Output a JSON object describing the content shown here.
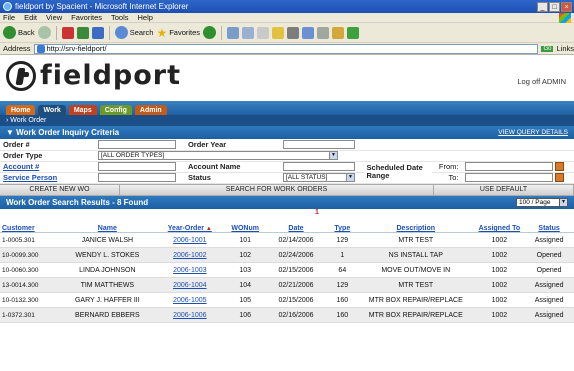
{
  "window": {
    "title": "fieldport by Spacient - Microsoft Internet Explorer"
  },
  "menu": [
    "File",
    "Edit",
    "View",
    "Favorites",
    "Tools",
    "Help"
  ],
  "toolbar": {
    "back": "Back",
    "search": "Search",
    "favorites": "Favorites"
  },
  "address": {
    "label": "Address",
    "url": "http://srv-fieldport/",
    "go": "Go",
    "links": "Links"
  },
  "brand": {
    "name": "fieldport",
    "logoff": "Log off ADMIN"
  },
  "tabs": [
    "Home",
    "Work",
    "Maps",
    "Config",
    "Admin"
  ],
  "subnav": "› Work Order",
  "inquiry": {
    "title": "Work Order Inquiry Criteria",
    "view_query": "VIEW QUERY DETAILS",
    "order_num": "Order #",
    "order_year": "Order Year",
    "order_type": "Order Type",
    "order_type_value": "[ALL ORDER TYPES]",
    "account_num": "Account #",
    "account_name": "Account Name",
    "scheduled_range": "Scheduled Date Range",
    "from": "From:",
    "to": "To:",
    "service_person": "Service Person",
    "status": "Status",
    "status_value": "[ALL STATUS]"
  },
  "buttons": {
    "create": "CREATE NEW WO",
    "search": "SEARCH FOR WORK ORDERS",
    "default": "USE DEFAULT"
  },
  "results": {
    "title": "Work Order Search Results - 8 Found",
    "per_page": "100 / Page",
    "page_indicator": "1",
    "headers": [
      "Customer",
      "Name",
      "Year-Order",
      "WONum",
      "Date",
      "Type",
      "Description",
      "Assigned To",
      "Status"
    ],
    "rows": [
      [
        "1-0005.301",
        "JANICE WALSH",
        "2006-1001",
        "101",
        "02/14/2006",
        "129",
        "MTR TEST",
        "1002",
        "Assigned"
      ],
      [
        "10-0099.300",
        "WENDY L. STOKES",
        "2006-1002",
        "102",
        "02/24/2006",
        "1",
        "NS INSTALL TAP",
        "1002",
        "Opened"
      ],
      [
        "10-0060.300",
        "LINDA JOHNSON",
        "2006-1003",
        "103",
        "02/15/2006",
        "64",
        "MOVE OUT/MOVE IN",
        "1002",
        "Opened"
      ],
      [
        "13-0014.300",
        "TIM MATTHEWS",
        "2006-1004",
        "104",
        "02/21/2006",
        "129",
        "MTR TEST",
        "1002",
        "Assigned"
      ],
      [
        "10-0132.300",
        "GARY J. HAFFER III",
        "2006-1005",
        "105",
        "02/15/2006",
        "160",
        "MTR BOX REPAIR/REPLACE",
        "1002",
        "Assigned"
      ],
      [
        "1-0372.301",
        "BERNARD EBBERS",
        "2006-1006",
        "106",
        "02/16/2006",
        "160",
        "MTR BOX REPAIR/REPLACE",
        "1002",
        "Assigned"
      ]
    ]
  }
}
